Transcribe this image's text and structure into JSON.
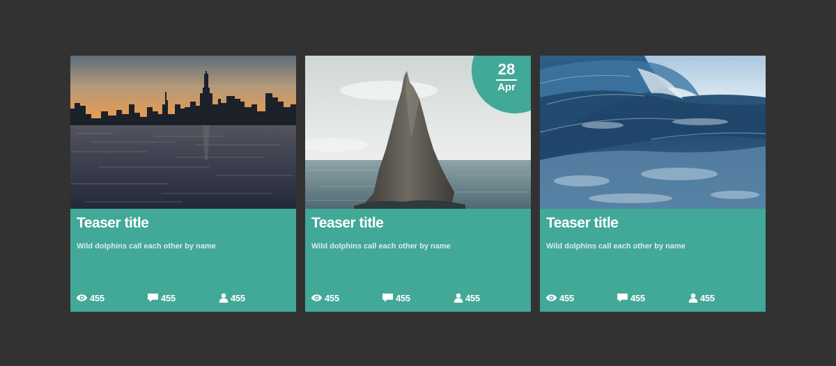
{
  "cards": [
    {
      "title": "Teaser title",
      "description": "Wild dolphins call each other by name",
      "image": "city-skyline-over-water",
      "stats": [
        {
          "icon": "views-icon",
          "value": "455"
        },
        {
          "icon": "comments-icon",
          "value": "455"
        },
        {
          "icon": "user-icon",
          "value": "455"
        }
      ]
    },
    {
      "title": "Teaser title",
      "description": "Wild dolphins call each other by name",
      "image": "sea-rock-spire",
      "date": {
        "day": "28",
        "month": "Apr"
      },
      "stats": [
        {
          "icon": "views-icon",
          "value": "455"
        },
        {
          "icon": "comments-icon",
          "value": "455"
        },
        {
          "icon": "user-icon",
          "value": "455"
        }
      ]
    },
    {
      "title": "Teaser title",
      "description": "Wild dolphins call each other by name",
      "image": "ocean-wave",
      "stats": [
        {
          "icon": "views-icon",
          "value": "455"
        },
        {
          "icon": "comments-icon",
          "value": "455"
        },
        {
          "icon": "user-icon",
          "value": "455"
        }
      ]
    }
  ],
  "colors": {
    "background": "#323232",
    "card": "#42a897",
    "text": "#ffffff"
  }
}
